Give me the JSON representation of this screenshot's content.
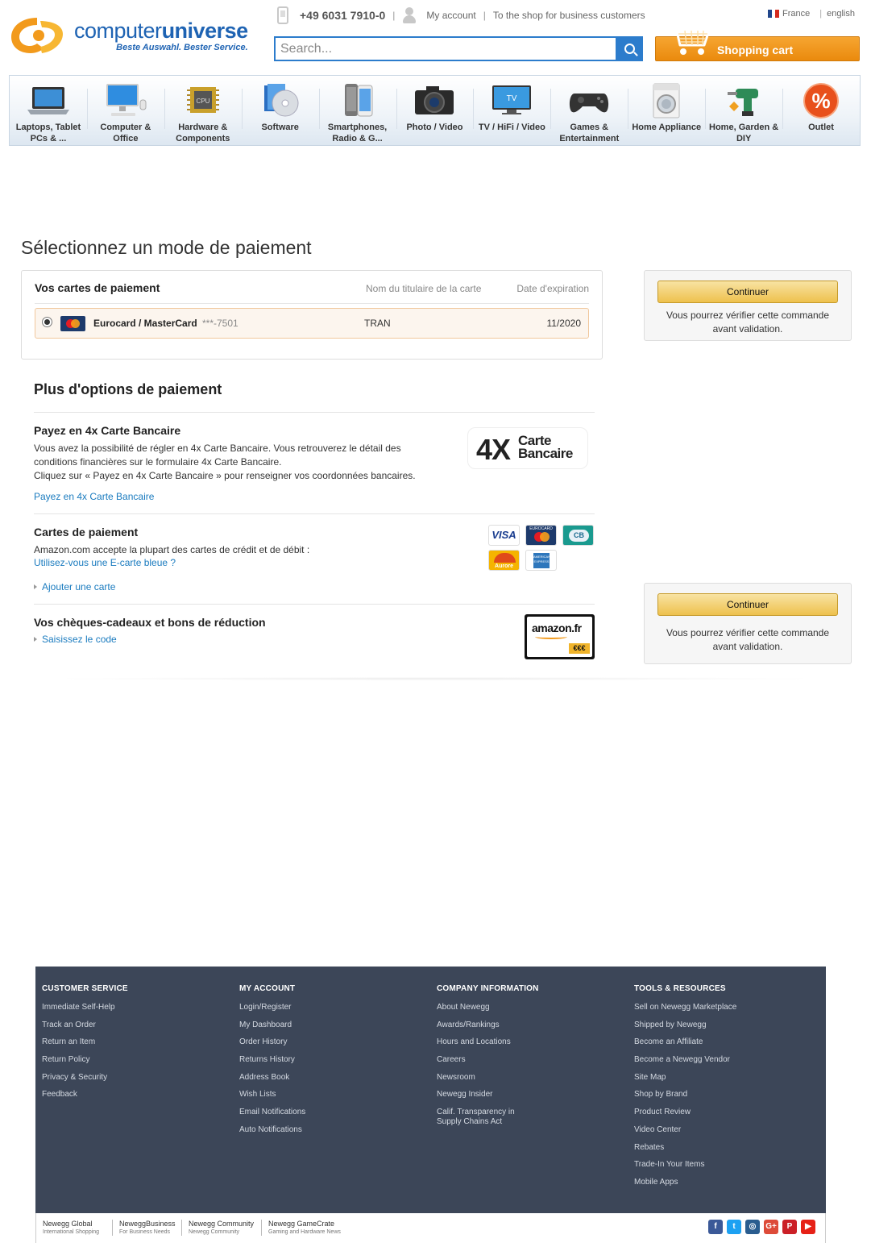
{
  "header": {
    "logo_name_light": "computer",
    "logo_name_bold": "universe",
    "logo_tagline": "Beste Auswahl. Bester Service.",
    "phone": "+49 6031 7910-0",
    "separator": "|",
    "my_account": "My account",
    "business_link": "To the shop for business customers",
    "lang_country": "France",
    "lang_separator": "|",
    "lang_language": "english",
    "search_placeholder": "Search...",
    "cart_label": "Shopping cart",
    "icons": {
      "phone": "phone-icon",
      "user": "user-icon",
      "search": "search-icon",
      "cart": "cart-icon",
      "flag": "france-flag-icon"
    }
  },
  "categories": [
    {
      "label": "Laptops, Tablet PCs & ...",
      "icon": "laptop-icon"
    },
    {
      "label": "Computer & Office",
      "icon": "desktop-computer-icon"
    },
    {
      "label": "Hardware & Components",
      "icon": "cpu-chip-icon"
    },
    {
      "label": "Software",
      "icon": "software-disc-icon"
    },
    {
      "label": "Smartphones, Radio & G...",
      "icon": "smartphone-icon"
    },
    {
      "label": "Photo / Video",
      "icon": "camera-icon"
    },
    {
      "label": "TV / HiFi / Video",
      "icon": "tv-icon"
    },
    {
      "label": "Games & Entertainment",
      "icon": "gamepad-icon"
    },
    {
      "label": "Home Appliance",
      "icon": "washing-machine-icon"
    },
    {
      "label": "Home, Garden & DIY",
      "icon": "drill-icon"
    },
    {
      "label": "Outlet",
      "icon": "percent-icon"
    }
  ],
  "main": {
    "title": "Sélectionnez un mode de paiement",
    "cards": {
      "title": "Vos cartes de paiement",
      "col_holder": "Nom du titulaire de la carte",
      "col_expiry": "Date d'expiration",
      "row": {
        "name": "Eurocard / MasterCard",
        "number": "***-7501",
        "holder": "TRAN",
        "expiry": "11/2020",
        "selected": true,
        "icon": "mastercard-icon"
      }
    },
    "continue_label": "Continuer",
    "continue_note": "Vous pourrez vérifier cette commande avant validation.",
    "more_title": "Plus d'options de paiement",
    "option_4x": {
      "title": "Payez en 4x Carte Bancaire",
      "text1": "Vous avez la possibilité de régler en 4x Carte Bancaire. Vous retrouverez le détail des conditions financières sur le formulaire 4x Carte Bancaire.",
      "text2": "Cliquez sur « Payez en 4x Carte Bancaire » pour renseigner vos coordonnées bancaires.",
      "link": "Payez en 4x Carte Bancaire",
      "logo_big": "4X",
      "logo_small_1": "Carte",
      "logo_small_2": "Bancaire"
    },
    "option_cards": {
      "title": "Cartes de paiement",
      "text": "Amazon.com accepte la plupart des cartes de crédit et de débit :",
      "link_ecard": "Utilisez-vous une E-carte bleue ?",
      "link_add": "Ajouter une carte",
      "logos": [
        "VISA",
        "EUROCARD",
        "CB",
        "Aurore",
        "AMERICAN EXPRESS"
      ]
    },
    "option_gift": {
      "title": "Vos chèques-cadeaux et bons de réduction",
      "link": "Saisissez le code",
      "card_brand": "amazon.fr",
      "card_badge": "€€€"
    }
  },
  "footer": {
    "columns": [
      {
        "heading": "CUSTOMER SERVICE",
        "items": [
          "Immediate Self-Help",
          "Track an Order",
          "Return an Item",
          "Return Policy",
          "Privacy & Security",
          "Feedback"
        ]
      },
      {
        "heading": "MY ACCOUNT",
        "items": [
          "Login/Register",
          "My Dashboard",
          "Order History",
          "Returns History",
          "Address Book",
          "Wish Lists",
          "Email Notifications",
          "Auto Notifications"
        ]
      },
      {
        "heading": "COMPANY INFORMATION",
        "items": [
          "About Newegg",
          "Awards/Rankings",
          "Hours and Locations",
          "Careers",
          "Newsroom",
          "Newegg Insider",
          "Calif. Transparency in Supply Chains Act"
        ]
      },
      {
        "heading": "TOOLS & RESOURCES",
        "items": [
          "Sell on Newegg Marketplace",
          "Shipped by Newegg",
          "Become an Affiliate",
          "Become a Newegg Vendor",
          "Site Map",
          "Shop by Brand",
          "Product Review",
          "Video Center",
          "Rebates",
          "Trade-In Your Items",
          "Mobile Apps"
        ]
      }
    ],
    "bottom_links": [
      {
        "name": "Newegg Global",
        "sub": "International Shopping"
      },
      {
        "name": "NeweggBusiness",
        "sub": "For Business Needs"
      },
      {
        "name": "Newegg Community",
        "sub": "Newegg Community"
      },
      {
        "name": "Newegg GameCrate",
        "sub": "Gaming and Hardware News"
      }
    ],
    "socials": [
      {
        "icon": "facebook-icon",
        "glyph": "f",
        "color": "#3b5998"
      },
      {
        "icon": "twitter-icon",
        "glyph": "t",
        "color": "#1da1f2"
      },
      {
        "icon": "instagram-icon",
        "glyph": "◎",
        "color": "#2a5d8f"
      },
      {
        "icon": "google-plus-icon",
        "glyph": "G+",
        "color": "#dd4b39"
      },
      {
        "icon": "pinterest-icon",
        "glyph": "P",
        "color": "#cb2027"
      },
      {
        "icon": "youtube-icon",
        "glyph": "▶",
        "color": "#e62117"
      }
    ]
  }
}
